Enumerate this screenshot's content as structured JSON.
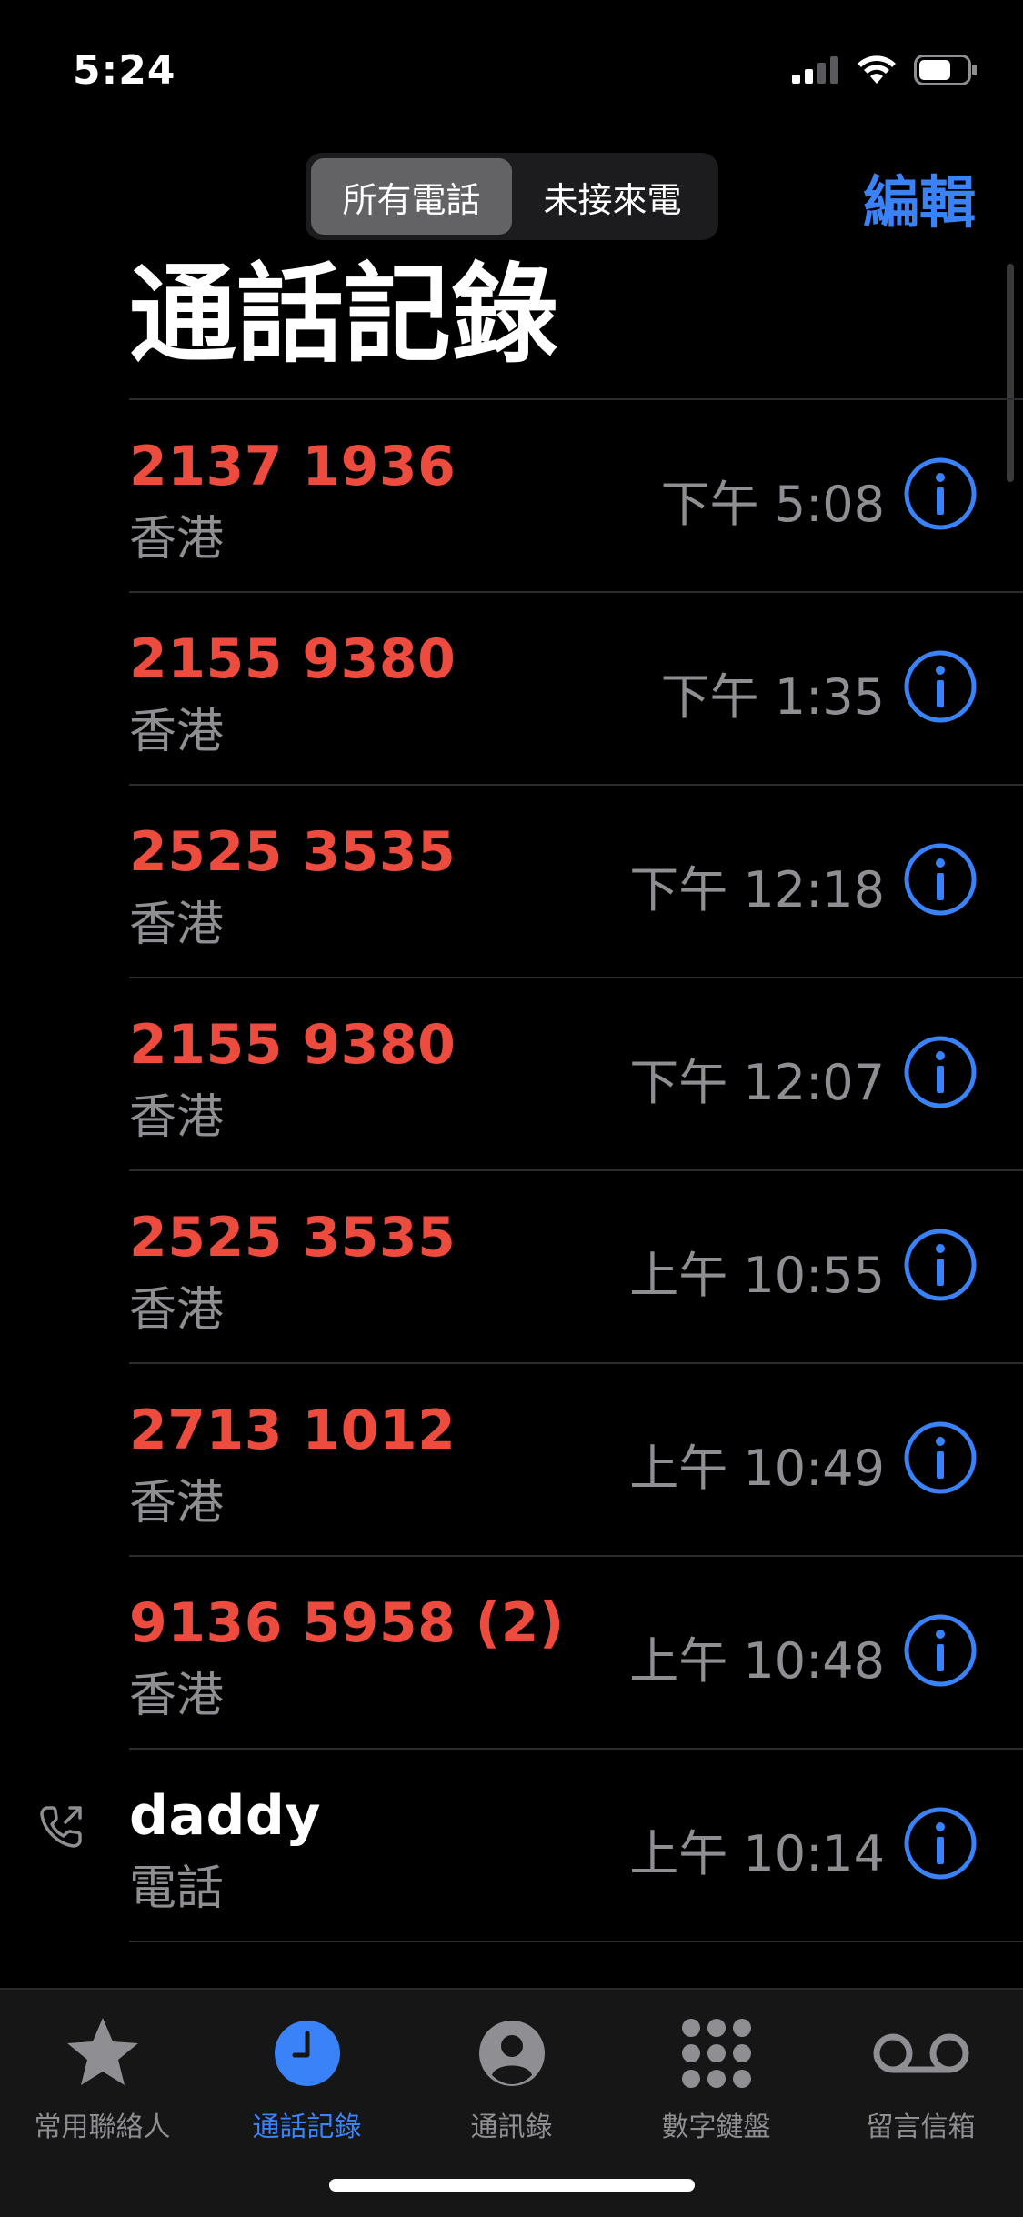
{
  "status": {
    "time": "5:24",
    "icons": [
      "signal-icon",
      "wifi-icon",
      "battery-icon"
    ]
  },
  "header": {
    "segments": [
      {
        "label": "所有電話",
        "active": true
      },
      {
        "label": "未接來電",
        "active": false
      }
    ],
    "edit_label": "編輯",
    "title": "通話記錄"
  },
  "calls": [
    {
      "name": "2137 1936",
      "sub": "香港",
      "time": "下午 5:08",
      "missed": true
    },
    {
      "name": "2155 9380",
      "sub": "香港",
      "time": "下午 1:35",
      "missed": true
    },
    {
      "name": "2525 3535",
      "sub": "香港",
      "time": "下午 12:18",
      "missed": true
    },
    {
      "name": "2155 9380",
      "sub": "香港",
      "time": "下午 12:07",
      "missed": true
    },
    {
      "name": "2525 3535",
      "sub": "香港",
      "time": "上午 10:55",
      "missed": true
    },
    {
      "name": "2713 1012",
      "sub": "香港",
      "time": "上午 10:49",
      "missed": true
    },
    {
      "name": "9136 5958 (2)",
      "sub": "香港",
      "time": "上午 10:48",
      "missed": true
    },
    {
      "name": "daddy",
      "sub": "電話",
      "time": "上午 10:14",
      "missed": false,
      "outgoing": true
    }
  ],
  "tabs": [
    {
      "label": "常用聯絡人",
      "icon": "star-icon",
      "active": false
    },
    {
      "label": "通話記錄",
      "icon": "clock-icon",
      "active": true
    },
    {
      "label": "通訊錄",
      "icon": "person-icon",
      "active": false
    },
    {
      "label": "數字鍵盤",
      "icon": "keypad-icon",
      "active": false
    },
    {
      "label": "留言信箱",
      "icon": "voicemail-icon",
      "active": false
    }
  ],
  "colors": {
    "accent": "#3a82f7",
    "missed": "#ee4b3f",
    "secondary": "#8e8e93",
    "background": "#000000"
  }
}
